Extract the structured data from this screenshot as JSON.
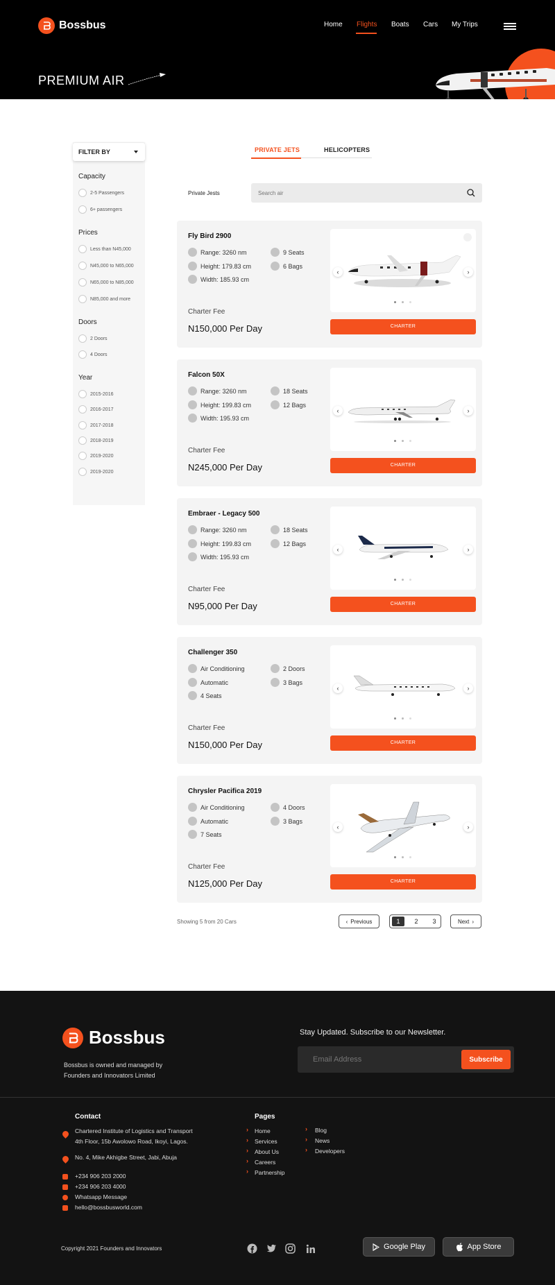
{
  "header": {
    "brand": "Bossbus",
    "nav": [
      {
        "label": "Home"
      },
      {
        "label": "Flights"
      },
      {
        "label": "Boats"
      },
      {
        "label": "Cars"
      },
      {
        "label": "My Trips"
      }
    ],
    "active_nav": "Flights",
    "hero_title": "PREMIUM AIR"
  },
  "sidebar": {
    "filter_label": "FILTER BY",
    "groups": [
      {
        "heading": "Capacity",
        "options": [
          "2-5 Passengers",
          "6+ passengers"
        ]
      },
      {
        "heading": "Prices",
        "options": [
          "Less than N45,000",
          "N45,000 to N65,000",
          "N65,000 to N85,000",
          "N85,000 and more"
        ]
      },
      {
        "heading": "Doors",
        "options": [
          "2 Doors",
          "4 Doors"
        ]
      },
      {
        "heading": "Year",
        "options": [
          "2015-2016",
          "2016-2017",
          "2017-2018",
          "2018-2019",
          "2019-2020",
          "2019-2020"
        ]
      }
    ]
  },
  "tabs": [
    {
      "label": "PRIVATE JETS",
      "active": true
    },
    {
      "label": "HELICOPTERS",
      "active": false
    }
  ],
  "search": {
    "label": "Private Jests",
    "placeholder": "Search air"
  },
  "listings": [
    {
      "title": "Fly Bird 2900",
      "features_left": [
        "Range: 3260 nm",
        "Height: 179.83 cm",
        "Width: 185.93 cm"
      ],
      "features_right": [
        "9 Seats",
        "6 Bags"
      ],
      "fee_label": "Charter Fee",
      "fee": "N150,000 Per Day",
      "button": "CHARTER"
    },
    {
      "title": "Falcon 50X",
      "features_left": [
        "Range: 3260 nm",
        "Height: 199.83 cm",
        "Width: 195.93 cm"
      ],
      "features_right": [
        "18 Seats",
        "12 Bags"
      ],
      "fee_label": "Charter Fee",
      "fee": "N245,000 Per Day",
      "button": "CHARTER"
    },
    {
      "title": "Embraer - Legacy 500",
      "features_left": [
        "Range: 3260 nm",
        "Height: 199.83 cm",
        "Width: 195.93 cm"
      ],
      "features_right": [
        "18 Seats",
        "12 Bags"
      ],
      "fee_label": "Charter Fee",
      "fee": "N95,000 Per Day",
      "button": "CHARTER"
    },
    {
      "title": "Challenger 350",
      "features_left": [
        "Air Conditioning",
        "Automatic",
        "4 Seats"
      ],
      "features_right": [
        "2 Doors",
        "3 Bags"
      ],
      "fee_label": "Charter Fee",
      "fee": "N150,000 Per Day",
      "button": "CHARTER"
    },
    {
      "title": "Chrysler Pacifica 2019",
      "features_left": [
        "Air Conditioning",
        "Automatic",
        "7 Seats"
      ],
      "features_right": [
        "4 Doors",
        "3 Bags"
      ],
      "fee_label": "Charter Fee",
      "fee": "N125,000 Per Day",
      "button": "CHARTER"
    }
  ],
  "pagination": {
    "showing": "Showing 5 from 20 Cars",
    "previous": "Previous",
    "pages": [
      "1",
      "2",
      "3"
    ],
    "current": "1",
    "next": "Next"
  },
  "footer": {
    "brand": "Bossbus",
    "description": "Bossbus is owned and managed by Founders and Innovators Limited",
    "newsletter_title": "Stay Updated. Subscribe to our Newsletter.",
    "email_placeholder": "Email Address",
    "subscribe": "Subscribe",
    "contact_heading": "Contact",
    "address1_line1": "Chartered Institute of Logistics and Transport",
    "address1_line2": "4th Floor, 15b Awolowo Road, Ikoyi, Lagos.",
    "address2": "No. 4, Mike Akhigbe Street, Jabi, Abuja",
    "phone1": "+234 906 203 2000",
    "phone2": "+234 906 203 4000",
    "whatsapp": "Whatsapp Message",
    "email": "hello@bossbusworld.com",
    "pages_heading": "Pages",
    "pages_col1": [
      "Home",
      "Services",
      "About Us",
      "Careers",
      "Partnership"
    ],
    "pages_col2": [
      "Blog",
      "News",
      "Developers"
    ],
    "copyright": "Copyright 2021 Founders and Innovators",
    "social": [
      "facebook-icon",
      "twitter-icon",
      "instagram-icon",
      "linkedin-icon"
    ],
    "google_play": "Google Play",
    "app_store": "App Store"
  },
  "colors": {
    "accent": "#f4511e",
    "header_bg": "#000000",
    "footer_bg": "#131313",
    "card_bg": "#f4f4f4"
  }
}
